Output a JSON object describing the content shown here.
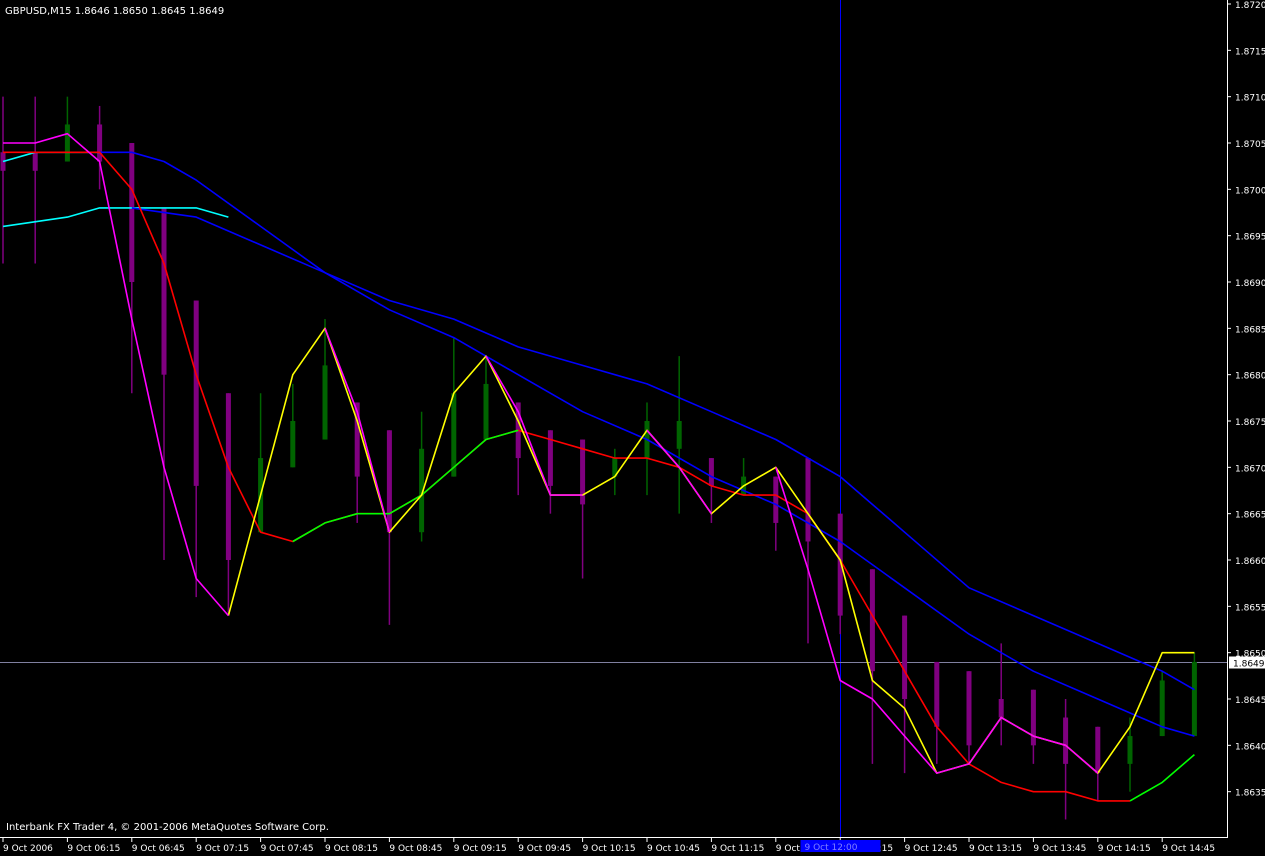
{
  "header": {
    "symbol_info": "GBPUSD,M15  1.8646 1.8650 1.8645 1.8649"
  },
  "footer": {
    "copyright": "Interbank FX Trader 4, © 2001-2006 MetaQuotes Software Corp."
  },
  "cursor": {
    "date_label": "9 Oct 12:00"
  },
  "colors": {
    "background": "#000000",
    "axis": "#ffffff",
    "bear_candle": "#800080",
    "bull_candle": "#006400",
    "price_line": "#8080a0",
    "crosshair": "#0000ff",
    "ma_red": "#ff0000",
    "ma_green": "#00ff00",
    "ma_yellow": "#ffff00",
    "ma_magenta": "#ff00ff",
    "ma_blue": "#0000ff",
    "ma_cyan": "#00ffff"
  },
  "chart_data": {
    "type": "line",
    "title": "GBPUSD,M15",
    "ylim": [
      1.863,
      1.872
    ],
    "y_ticks": [
      "1.8720",
      "1.8715",
      "1.8710",
      "1.8705",
      "1.8700",
      "1.8695",
      "1.8690",
      "1.8685",
      "1.8680",
      "1.8675",
      "1.8670",
      "1.8665",
      "1.8660",
      "1.8655",
      "1.8650",
      "1.8645",
      "1.8640",
      "1.8635"
    ],
    "x_tick_labels": [
      "9 Oct 2006",
      "9 Oct 06:15",
      "9 Oct 06:45",
      "9 Oct 07:15",
      "9 Oct 07:45",
      "9 Oct 08:15",
      "9 Oct 08:45",
      "9 Oct 09:15",
      "9 Oct 09:45",
      "9 Oct 10:15",
      "9 Oct 10:45",
      "9 Oct 11:15",
      "9 Oct",
      "9 Oct 12:15",
      "9 Oct 12:45",
      "9 Oct 13:15",
      "9 Oct 13:45",
      "9 Oct 14:15",
      "9 Oct 14:45"
    ],
    "current_price": "1.8649",
    "crosshair_index": 26,
    "candles": [
      {
        "o": 1.8704,
        "h": 1.871,
        "l": 1.8692,
        "c": 1.8702
      },
      {
        "o": 1.8704,
        "h": 1.871,
        "l": 1.8692,
        "c": 1.8702
      },
      {
        "o": 1.8703,
        "h": 1.871,
        "l": 1.8703,
        "c": 1.8707
      },
      {
        "o": 1.8707,
        "h": 1.8709,
        "l": 1.87,
        "c": 1.8703
      },
      {
        "o": 1.8705,
        "h": 1.8705,
        "l": 1.8678,
        "c": 1.869
      },
      {
        "o": 1.8698,
        "h": 1.8698,
        "l": 1.866,
        "c": 1.868
      },
      {
        "o": 1.8688,
        "h": 1.8688,
        "l": 1.8656,
        "c": 1.8668
      },
      {
        "o": 1.8678,
        "h": 1.8678,
        "l": 1.8654,
        "c": 1.866
      },
      {
        "o": 1.8663,
        "h": 1.8678,
        "l": 1.8663,
        "c": 1.8671
      },
      {
        "o": 1.867,
        "h": 1.8679,
        "l": 1.867,
        "c": 1.8675
      },
      {
        "o": 1.8673,
        "h": 1.8686,
        "l": 1.8673,
        "c": 1.8681
      },
      {
        "o": 1.8677,
        "h": 1.8677,
        "l": 1.8664,
        "c": 1.8669
      },
      {
        "o": 1.8674,
        "h": 1.8674,
        "l": 1.8653,
        "c": 1.8663
      },
      {
        "o": 1.8663,
        "h": 1.8676,
        "l": 1.8662,
        "c": 1.8672
      },
      {
        "o": 1.8669,
        "h": 1.8684,
        "l": 1.8669,
        "c": 1.8678
      },
      {
        "o": 1.8673,
        "h": 1.8682,
        "l": 1.8673,
        "c": 1.8679
      },
      {
        "o": 1.8677,
        "h": 1.8677,
        "l": 1.8667,
        "c": 1.8671
      },
      {
        "o": 1.8674,
        "h": 1.8674,
        "l": 1.8665,
        "c": 1.8668
      },
      {
        "o": 1.8673,
        "h": 1.8673,
        "l": 1.8658,
        "c": 1.8666
      },
      {
        "o": 1.8669,
        "h": 1.8672,
        "l": 1.8667,
        "c": 1.8671
      },
      {
        "o": 1.8671,
        "h": 1.8677,
        "l": 1.8667,
        "c": 1.8675
      },
      {
        "o": 1.8672,
        "h": 1.8682,
        "l": 1.8665,
        "c": 1.8675
      },
      {
        "o": 1.8671,
        "h": 1.8671,
        "l": 1.8664,
        "c": 1.8668
      },
      {
        "o": 1.8667,
        "h": 1.8671,
        "l": 1.8667,
        "c": 1.8669
      },
      {
        "o": 1.8669,
        "h": 1.8669,
        "l": 1.8661,
        "c": 1.8664
      },
      {
        "o": 1.8671,
        "h": 1.8671,
        "l": 1.8651,
        "c": 1.8662
      },
      {
        "o": 1.8665,
        "h": 1.8665,
        "l": 1.8652,
        "c": 1.8654
      },
      {
        "o": 1.8659,
        "h": 1.8659,
        "l": 1.8638,
        "c": 1.8648
      },
      {
        "o": 1.8654,
        "h": 1.8654,
        "l": 1.8637,
        "c": 1.8645
      },
      {
        "o": 1.8649,
        "h": 1.8649,
        "l": 1.8638,
        "c": 1.8642
      },
      {
        "o": 1.8648,
        "h": 1.8648,
        "l": 1.8638,
        "c": 1.864
      },
      {
        "o": 1.8645,
        "h": 1.8651,
        "l": 1.864,
        "c": 1.8643
      },
      {
        "o": 1.8646,
        "h": 1.8646,
        "l": 1.8638,
        "c": 1.864
      },
      {
        "o": 1.8643,
        "h": 1.8645,
        "l": 1.8632,
        "c": 1.8638
      },
      {
        "o": 1.8642,
        "h": 1.8642,
        "l": 1.8634,
        "c": 1.8637
      },
      {
        "o": 1.8638,
        "h": 1.8643,
        "l": 1.8635,
        "c": 1.8641
      },
      {
        "o": 1.8641,
        "h": 1.8648,
        "l": 1.8641,
        "c": 1.8647
      },
      {
        "o": 1.8641,
        "h": 1.865,
        "l": 1.8641,
        "c": 1.8649
      }
    ],
    "series": [
      {
        "color": "#00ffff",
        "x": [
          0,
          2,
          3,
          4,
          5,
          6,
          7
        ],
        "values": [
          1.8696,
          1.8697,
          1.8698,
          1.8698,
          1.8698,
          1.8698,
          1.8697
        ]
      },
      {
        "color": "#0000ff",
        "x": [
          4,
          6,
          8,
          10,
          12,
          14,
          16,
          18,
          20,
          22,
          24,
          26,
          28,
          30,
          32,
          34,
          36,
          37
        ],
        "values": [
          1.8698,
          1.8697,
          1.8694,
          1.8691,
          1.8688,
          1.8686,
          1.8683,
          1.8681,
          1.8679,
          1.8676,
          1.8673,
          1.8669,
          1.8663,
          1.8657,
          1.8654,
          1.8651,
          1.8648,
          1.8646
        ]
      },
      {
        "color": "#00ffff",
        "x": [
          0,
          1,
          2,
          3
        ],
        "values": [
          1.8703,
          1.8704,
          1.8704,
          1.8704
        ]
      },
      {
        "color": "#0000ff",
        "x": [
          3,
          4,
          5,
          6,
          8,
          10,
          12,
          14,
          16,
          18,
          20,
          22,
          24,
          26,
          28,
          30,
          32,
          34,
          36,
          37
        ],
        "values": [
          1.8704,
          1.8704,
          1.8703,
          1.8701,
          1.8696,
          1.8691,
          1.8687,
          1.8684,
          1.868,
          1.8676,
          1.8673,
          1.8669,
          1.8666,
          1.8662,
          1.8657,
          1.8652,
          1.8648,
          1.8645,
          1.8642,
          1.8641
        ]
      },
      {
        "color": "#ff0000",
        "x": [
          0,
          1,
          2,
          3,
          4,
          5,
          6,
          7,
          8,
          9,
          10,
          11,
          12,
          13,
          14,
          15,
          16,
          17,
          18,
          19,
          20,
          21,
          22,
          23,
          24,
          25,
          26,
          27,
          28,
          29,
          30,
          31,
          32,
          33,
          34,
          35
        ],
        "values": [
          1.8704,
          1.8704,
          1.8704,
          1.8704,
          1.87,
          1.8692,
          1.868,
          1.867,
          1.8663,
          1.8662,
          1.8664,
          1.8665,
          1.8665,
          1.8667,
          1.867,
          1.8673,
          1.8674,
          1.8673,
          1.8672,
          1.8671,
          1.8671,
          1.867,
          1.8668,
          1.8667,
          1.8667,
          1.8665,
          1.866,
          1.8654,
          1.8648,
          1.8642,
          1.8638,
          1.8636,
          1.8635,
          1.8635,
          1.8634,
          1.8634
        ]
      },
      {
        "color": "#00ff00",
        "x": [
          9,
          10,
          11,
          12,
          13,
          14,
          15,
          16
        ],
        "values": [
          1.8662,
          1.8664,
          1.8665,
          1.8665,
          1.8667,
          1.867,
          1.8673,
          1.8674
        ]
      },
      {
        "color": "#00ff00",
        "x": [
          35,
          36,
          37
        ],
        "values": [
          1.8634,
          1.8636,
          1.8639
        ]
      },
      {
        "color": "#ffff00",
        "x": [
          7,
          8,
          9,
          10,
          11,
          12,
          13,
          14,
          15,
          16,
          17,
          18,
          19,
          20,
          21,
          22,
          23,
          24,
          25,
          26,
          27,
          28,
          29,
          30,
          31,
          32,
          33,
          34,
          35,
          36,
          37
        ],
        "values": [
          1.8654,
          1.8667,
          1.868,
          1.8685,
          1.8675,
          1.8663,
          1.8667,
          1.8678,
          1.8682,
          1.8675,
          1.8667,
          1.8667,
          1.8669,
          1.8674,
          1.867,
          1.8665,
          1.8668,
          1.867,
          1.8665,
          1.866,
          1.8647,
          1.8644,
          1.8637,
          1.8638,
          1.8643,
          1.8641,
          1.864,
          1.8637,
          1.8642,
          1.865,
          1.865
        ]
      },
      {
        "color": "#ff00ff",
        "x": [
          0,
          1,
          2,
          3,
          4,
          5,
          6,
          7
        ],
        "values": [
          1.8705,
          1.8705,
          1.8706,
          1.8703,
          1.8686,
          1.867,
          1.8658,
          1.8654
        ]
      },
      {
        "color": "#ff00ff",
        "x": [
          10,
          11,
          12
        ],
        "values": [
          1.8685,
          1.8676,
          1.8663
        ]
      },
      {
        "color": "#ff00ff",
        "x": [
          15,
          16,
          17,
          18
        ],
        "values": [
          1.8682,
          1.8676,
          1.8667,
          1.8667
        ]
      },
      {
        "color": "#ff00ff",
        "x": [
          20,
          21,
          22
        ],
        "values": [
          1.8674,
          1.867,
          1.8665
        ]
      },
      {
        "color": "#ff00ff",
        "x": [
          24,
          25,
          26,
          27,
          28,
          29,
          30,
          31,
          32,
          33,
          34
        ],
        "values": [
          1.867,
          1.8659,
          1.8647,
          1.8645,
          1.8641,
          1.8637,
          1.8638,
          1.8643,
          1.8641,
          1.864,
          1.8637
        ]
      }
    ]
  }
}
